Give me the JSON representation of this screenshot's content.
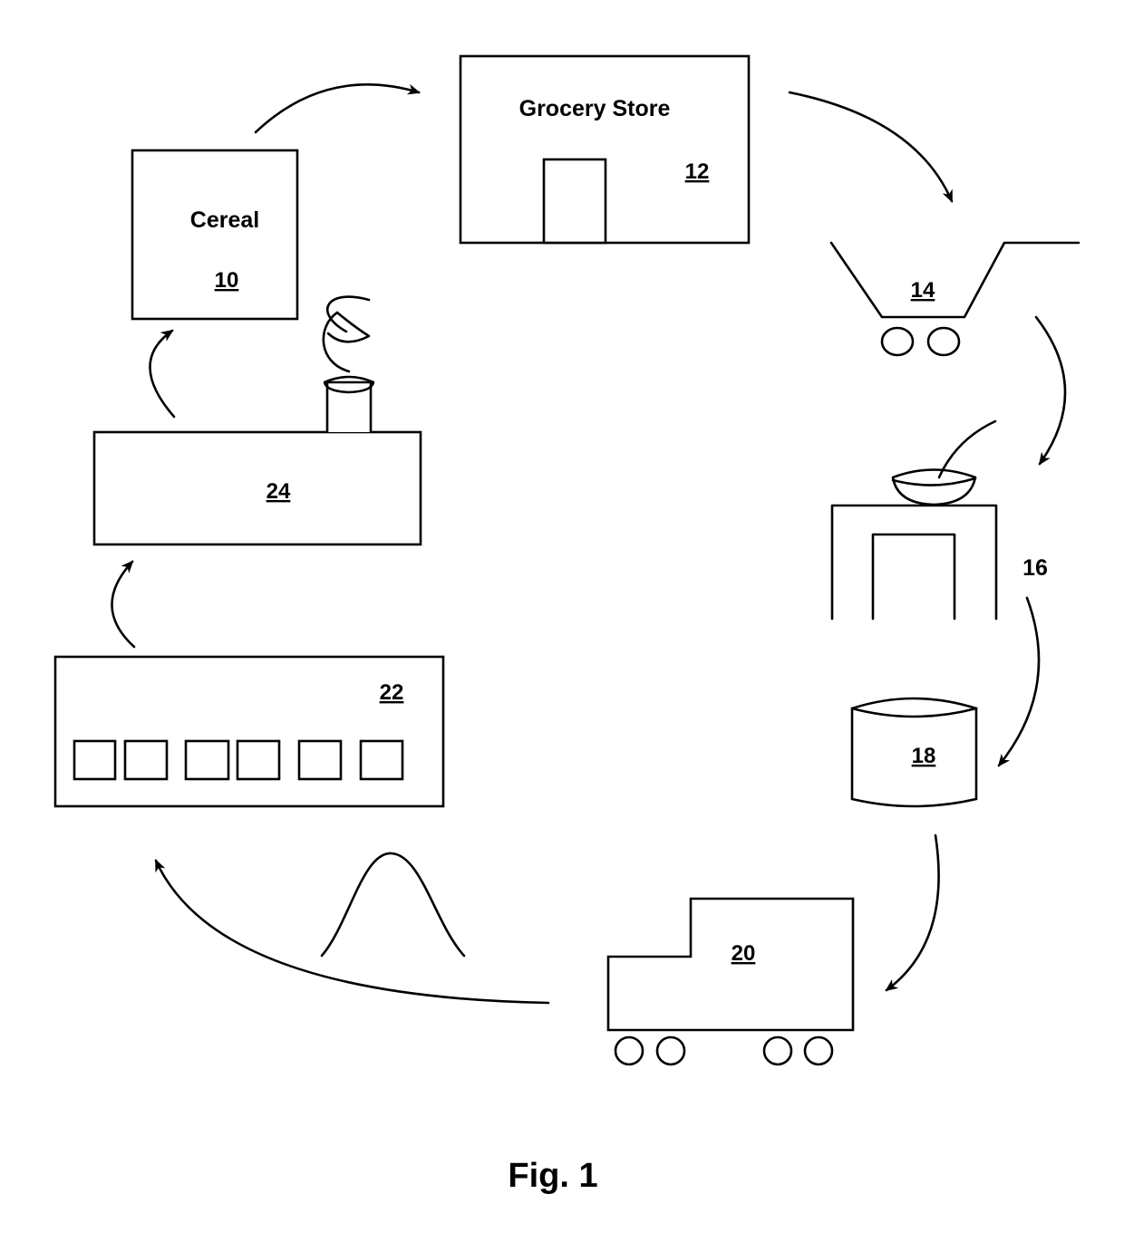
{
  "figure": {
    "caption": "Fig. 1",
    "nodes": {
      "cereal": {
        "title": "Cereal",
        "ref": "10"
      },
      "grocery_store": {
        "title": "Grocery Store",
        "ref": "12"
      },
      "cart": {
        "ref": "14"
      },
      "table_bowl": {
        "ref": "16"
      },
      "bin": {
        "ref": "18"
      },
      "truck": {
        "ref": "20"
      },
      "facility": {
        "ref": "22"
      },
      "factory": {
        "ref": "24"
      }
    },
    "flow_order": [
      "10",
      "12",
      "14",
      "16",
      "18",
      "20",
      "22",
      "24",
      "10"
    ]
  }
}
